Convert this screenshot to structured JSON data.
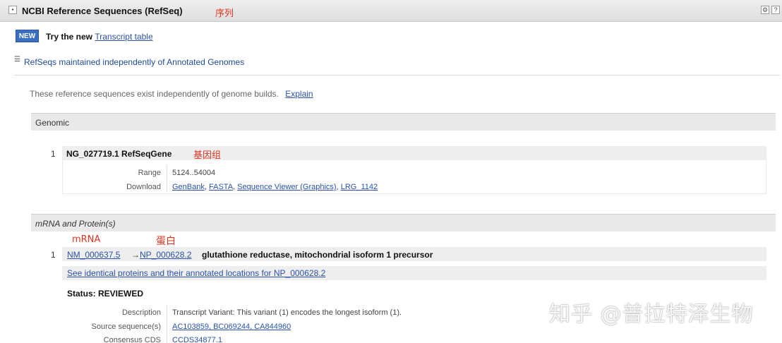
{
  "header": {
    "toggle": "▪",
    "title": "NCBI Reference Sequences (RefSeq)",
    "annotation": "序列",
    "icons": [
      "gear-icon",
      "help-icon"
    ],
    "icon_glyphs": [
      "⚙",
      "?"
    ]
  },
  "banner": {
    "badge": "NEW",
    "text": "Try the new",
    "link": "Transcript table"
  },
  "section": {
    "toggle": "☰",
    "title": "RefSeqs maintained independently of Annotated Genomes",
    "intro": "These reference sequences exist independently of genome builds.",
    "explain_link": "Explain"
  },
  "genomic": {
    "heading": "Genomic",
    "number": "1",
    "accession": "NG_027719.1 RefSeqGene",
    "annotation": "基因组",
    "range_label": "Range",
    "range_value": "5124..54004",
    "download_label": "Download",
    "downloads": [
      "GenBank",
      "FASTA",
      "Sequence Viewer (Graphics)",
      "LRG_1142"
    ]
  },
  "mrna": {
    "heading": "mRNA and Protein(s)",
    "annotation_mrna": "mRNA",
    "annotation_protein": "蛋白",
    "number": "1",
    "mrna_accession": "NM_000637.5",
    "separator": "→",
    "protein_accession": "NP_000628.2",
    "description": "glutathione reductase, mitochondrial isoform 1 precursor",
    "identical_link": "See identical proteins and their annotated locations for NP_000628.2",
    "status": "Status: REVIEWED",
    "desc_label": "Description",
    "desc_value": "Transcript Variant: This variant (1) encodes the longest isoform (1).",
    "source_label": "Source sequence(s)",
    "source_value": "AC103859, BC069244, CA844960",
    "ccds_label": "Consensus CDS",
    "ccds_value": "CCDS34877.1"
  },
  "watermark": "知乎 @普拉特泽生物",
  "colors": {
    "link": "#2a52a8",
    "annotation": "#e0341f",
    "badge": "#3a6fc0"
  }
}
